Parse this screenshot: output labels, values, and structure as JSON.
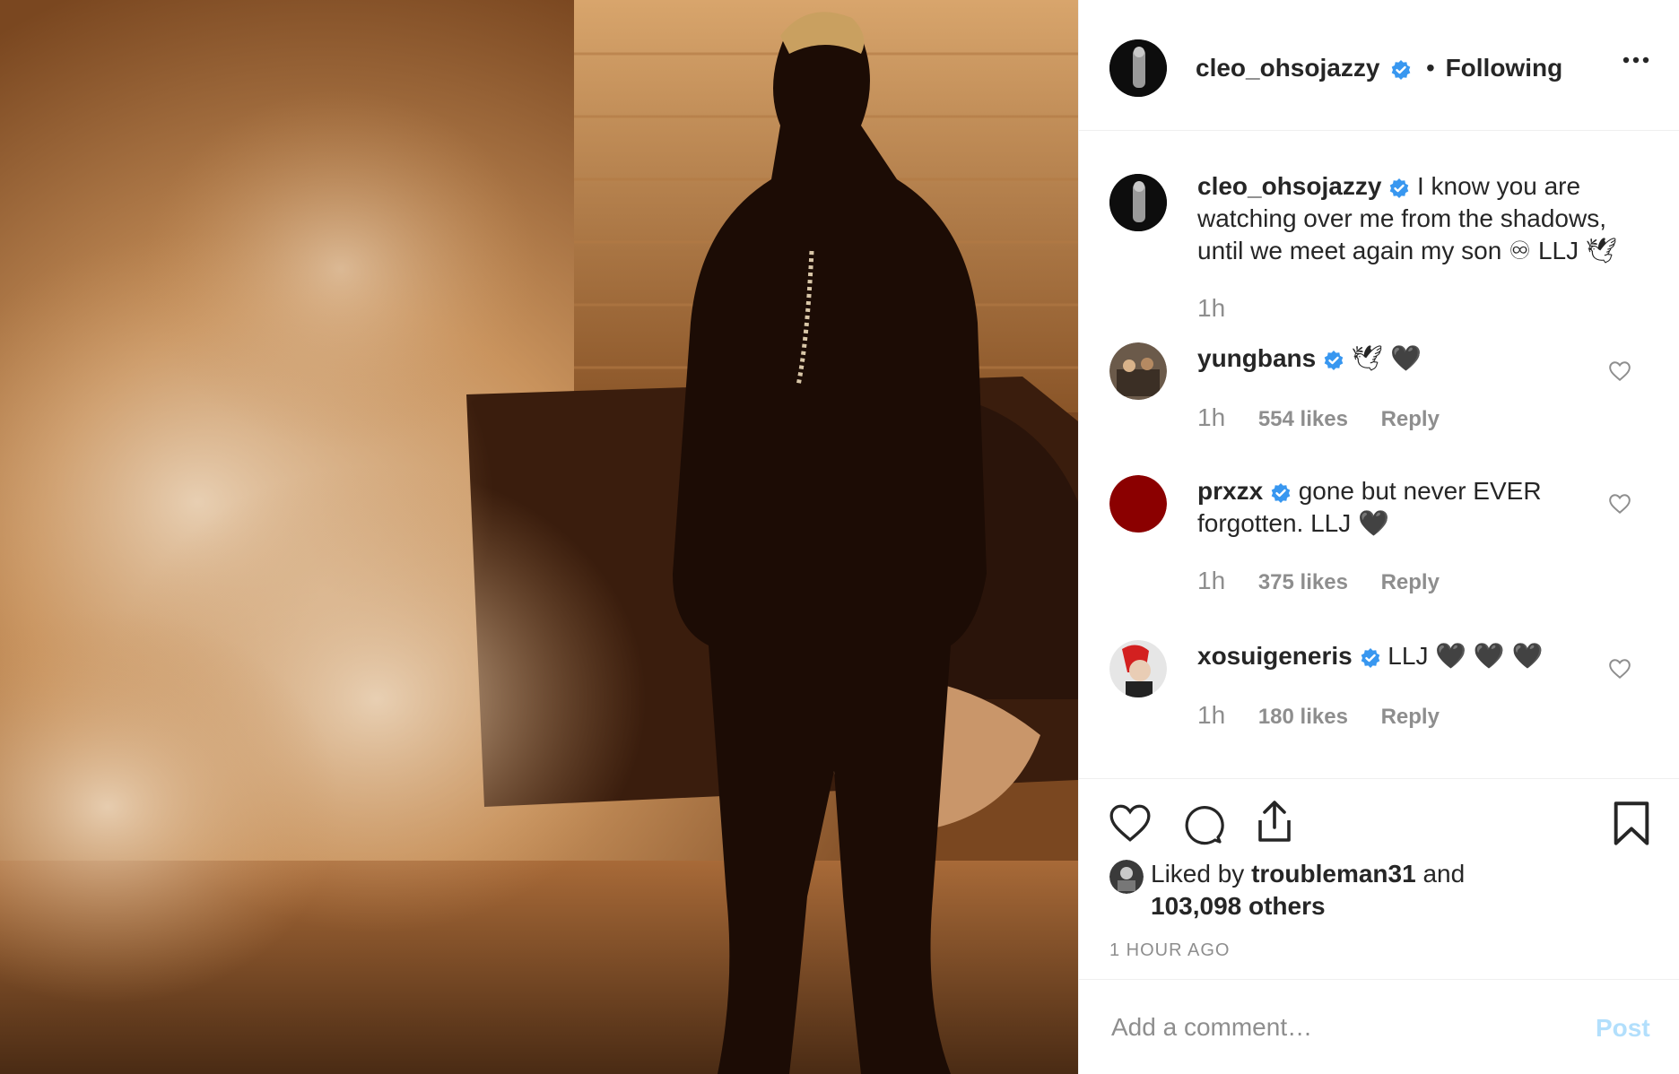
{
  "post": {
    "author": "cleo_ohsojazzy",
    "follow_sep": "•",
    "follow_label": "Following",
    "caption": "I know you are watching over me from the shadows, until we meet again my son ♾ LLJ 🕊",
    "caption_time": "1h"
  },
  "comments": [
    {
      "user": "yungbans",
      "text": "🕊 🖤",
      "time": "1h",
      "likes": "554 likes",
      "reply": "Reply",
      "avatar_color": "#6b5a4a"
    },
    {
      "user": "prxzx",
      "text": "gone but never EVER forgotten. LLJ 🖤",
      "time": "1h",
      "likes": "375 likes",
      "reply": "Reply",
      "avatar_color": "#8b0000"
    },
    {
      "user": "xosuigeneris",
      "text": "LLJ 🖤 🖤 🖤",
      "time": "1h",
      "likes": "180 likes",
      "reply": "Reply",
      "avatar_color": "#c8c8c8"
    }
  ],
  "likes": {
    "liked_by_prefix": "Liked by",
    "liked_by_user": "troubleman31",
    "and": "and",
    "others": "103,098 others"
  },
  "timestamp": "1 HOUR AGO",
  "add_comment": {
    "placeholder": "Add a comment…",
    "post_label": "Post"
  },
  "colors": {
    "verified": "#3897f0",
    "post_button": "#b2dffc",
    "photo_warm": "#c88a4a"
  }
}
